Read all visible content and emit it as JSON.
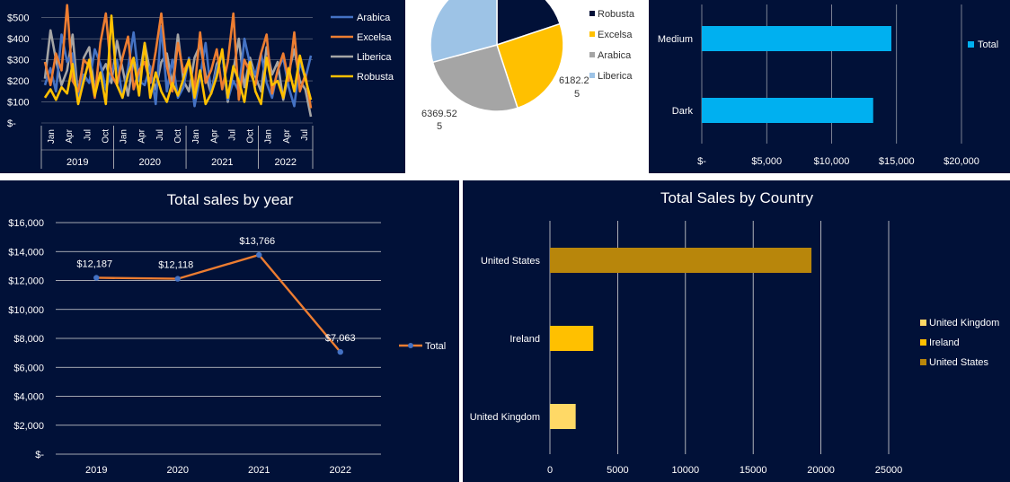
{
  "colors": {
    "background": "#011138",
    "arabica": "#4472C4",
    "excelsa": "#ED7D31",
    "liberica": "#A5A5A5",
    "robusta": "#FFC000",
    "roast_bar": "#00B0F0",
    "line": "#ED7D31",
    "line_marker": "#4472C4",
    "country_us": "#B8860B",
    "country_ireland": "#FFC000",
    "country_uk": "#FFD966"
  },
  "chart_data": [
    {
      "id": "monthly_by_type",
      "type": "line",
      "y_ticks": [
        "$-",
        "$100",
        "$200",
        "$300",
        "$400",
        "$500"
      ],
      "ylim": [
        0,
        550
      ],
      "month_ticks": [
        "Jan",
        "Apr",
        "Jul",
        "Oct",
        "Jan",
        "Apr",
        "Jul",
        "Oct",
        "Jan",
        "Apr",
        "Jul",
        "Oct",
        "Jan",
        "Apr",
        "Jul"
      ],
      "year_groups": [
        "2019",
        "2020",
        "2021",
        "2022"
      ],
      "series": [
        {
          "name": "Arabica",
          "values": [
            180,
            260,
            150,
            420,
            290,
            330,
            110,
            230,
            190,
            350,
            280,
            160,
            240,
            300,
            120,
            260,
            430,
            200,
            180,
            270,
            90,
            460,
            150,
            300,
            120,
            170,
            310,
            80,
            220,
            380,
            140,
            260,
            330,
            110,
            200,
            150,
            400,
            280,
            230,
            330,
            190,
            120,
            250,
            310,
            170,
            80,
            290,
            210,
            320
          ]
        },
        {
          "name": "Excelsa",
          "values": [
            290,
            180,
            330,
            250,
            560,
            200,
            150,
            300,
            270,
            120,
            380,
            520,
            230,
            180,
            310,
            410,
            160,
            250,
            290,
            190,
            340,
            520,
            270,
            150,
            380,
            240,
            300,
            160,
            430,
            190,
            250,
            350,
            160,
            290,
            520,
            110,
            300,
            240,
            180,
            330,
            420,
            140,
            250,
            330,
            200,
            430,
            150,
            230,
            70
          ]
        },
        {
          "name": "Liberica",
          "values": [
            210,
            440,
            300,
            180,
            250,
            420,
            120,
            310,
            360,
            150,
            230,
            280,
            190,
            390,
            260,
            130,
            300,
            210,
            380,
            240,
            160,
            290,
            330,
            180,
            420,
            200,
            150,
            310,
            370,
            230,
            140,
            280,
            330,
            100,
            250,
            400,
            170,
            310,
            220,
            150,
            360,
            230,
            290,
            110,
            240,
            350,
            200,
            160,
            30
          ]
        },
        {
          "name": "Robusta",
          "values": [
            120,
            160,
            110,
            170,
            140,
            280,
            90,
            200,
            300,
            130,
            240,
            90,
            510,
            180,
            120,
            230,
            310,
            130,
            380,
            120,
            240,
            150,
            100,
            190,
            130,
            210,
            300,
            120,
            250,
            90,
            140,
            220,
            350,
            120,
            270,
            200,
            100,
            290,
            150,
            90,
            310,
            180,
            200,
            120,
            260,
            150,
            320,
            210,
            110
          ]
        }
      ]
    },
    {
      "id": "type_share",
      "type": "pie",
      "legend": [
        "Robusta",
        "Excelsa",
        "Arabica",
        "Liberica"
      ],
      "values": [
        4900,
        6182.25,
        6369.525,
        7200
      ],
      "data_labels": [
        {
          "text": "6182.2",
          "cont": "5"
        },
        {
          "text": "6369.52",
          "cont": "5"
        }
      ]
    },
    {
      "id": "roast_type",
      "type": "bar",
      "categories": [
        "Medium",
        "Dark"
      ],
      "values": [
        14600,
        13200
      ],
      "x_ticks": [
        "$-",
        "$5,000",
        "$10,000",
        "$15,000",
        "$20,000"
      ],
      "xlim": [
        0,
        20000
      ],
      "legend": [
        "Total"
      ]
    },
    {
      "id": "sales_by_year",
      "type": "line",
      "title": "Total sales by year",
      "categories": [
        "2019",
        "2020",
        "2021",
        "2022"
      ],
      "values": [
        12187,
        12118,
        13766,
        7063
      ],
      "data_labels": [
        "$12,187",
        "$12,118",
        "$13,766",
        "$7,063"
      ],
      "y_ticks": [
        "$-",
        "$2,000",
        "$4,000",
        "$6,000",
        "$8,000",
        "$10,000",
        "$12,000",
        "$14,000",
        "$16,000"
      ],
      "ylim": [
        0,
        16000
      ],
      "legend": [
        "Total"
      ]
    },
    {
      "id": "sales_by_country",
      "type": "bar",
      "title": "Total Sales by Country",
      "categories": [
        "United States",
        "Ireland",
        "United Kingdom"
      ],
      "values": [
        19300,
        3200,
        1900
      ],
      "x_ticks": [
        "0",
        "5000",
        "10000",
        "15000",
        "20000",
        "25000"
      ],
      "xlim": [
        0,
        25000
      ],
      "legend": [
        "United Kingdom",
        "Ireland",
        "United States"
      ]
    }
  ]
}
